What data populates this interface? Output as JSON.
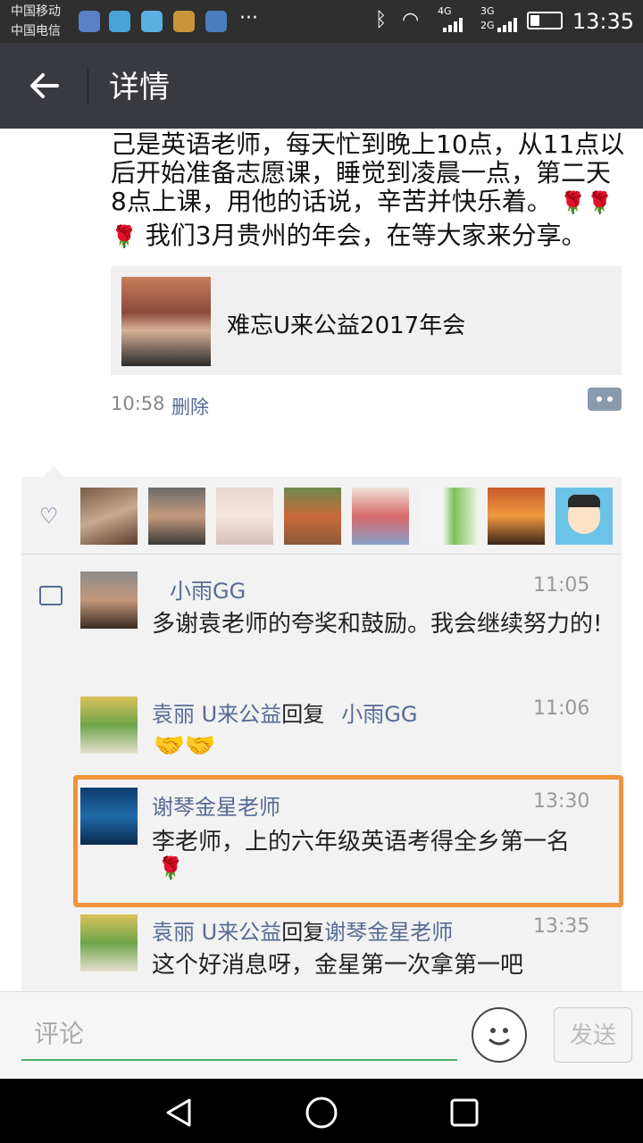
{
  "status_bar": {
    "carrier1": "中国移动",
    "carrier2": "中国电信",
    "network1": "4G",
    "network2": "3G",
    "network3": "2G",
    "time": "13:35"
  },
  "header": {
    "back_icon": "arrow-left-icon",
    "title": "详情"
  },
  "post": {
    "text_lines": [
      "己是英语老师，每天忙到晚上10点，从11点以",
      "后开始准备志愿课，睡觉到凌晨一点，第二天",
      "8点上课，用他的话说，辛苦并快乐着。",
      "我们3月贵州的年会，在等大家来分享。"
    ],
    "share_title": "难忘U来公益2017年会",
    "time": "10:58",
    "delete_label": "删除"
  },
  "comments": [
    {
      "name": "小雨GG",
      "time": "11:05",
      "text": "多谢袁老师的夸奖和鼓励。我会继续努力的!"
    },
    {
      "name": "袁丽 U来公益",
      "reply_label": "回复",
      "reply_to": "小雨GG",
      "time": "11:06",
      "text": ""
    },
    {
      "name": "谢琴金星老师",
      "time": "13:30",
      "text": "李老师，上的六年级英语考得全乡第一名"
    },
    {
      "name": "袁丽 U来公益",
      "reply_label": "回复",
      "reply_to": "谢琴金星老师",
      "time": "13:35",
      "text": "这个好消息呀，金星第一次拿第一吧"
    }
  ],
  "comment_bar": {
    "placeholder": "评论",
    "send_label": "发送"
  },
  "colors": {
    "link_blue": "#576b95",
    "highlight_orange": "#f0933a",
    "input_green": "#46b26b"
  }
}
